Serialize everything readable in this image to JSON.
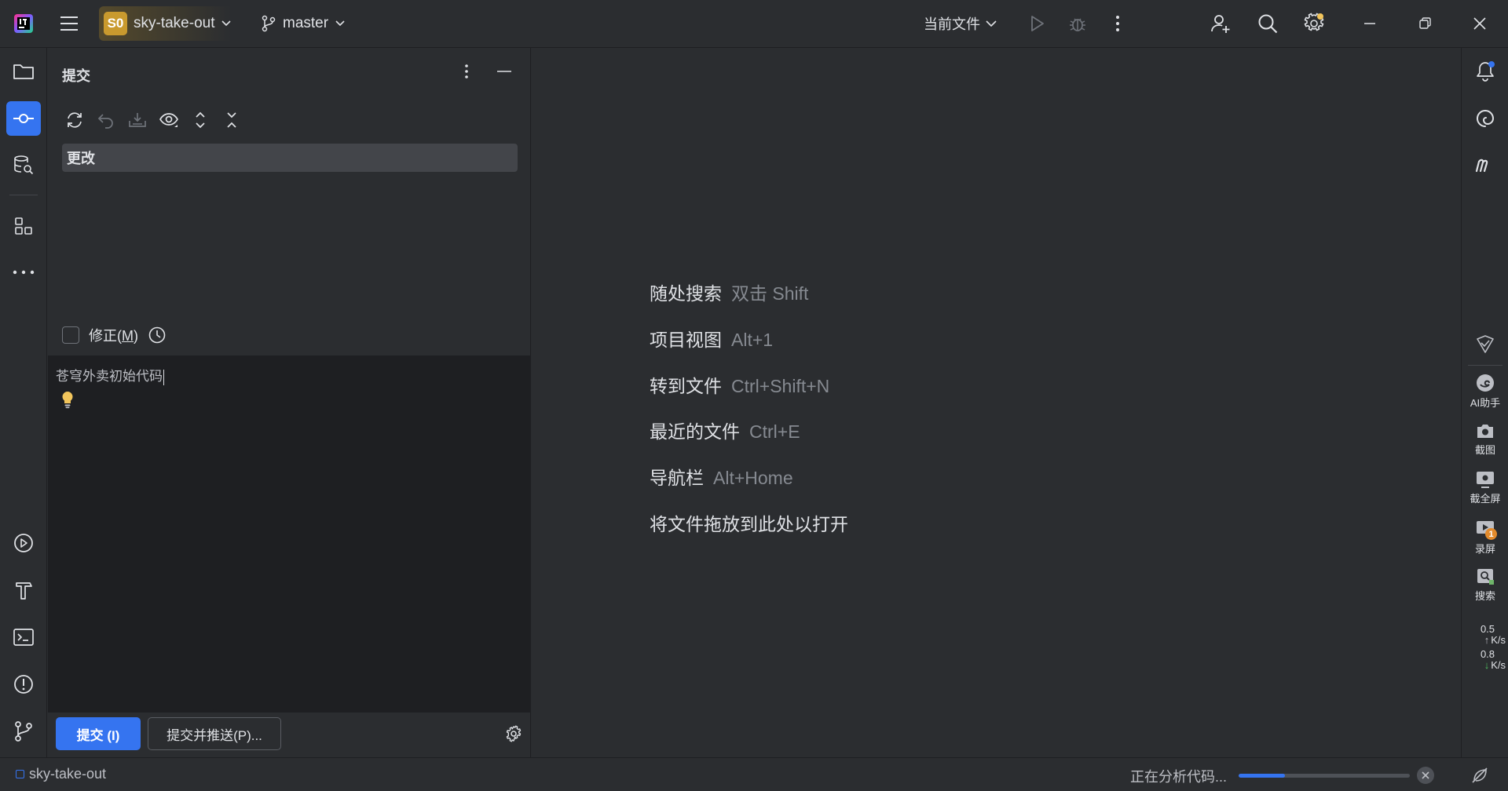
{
  "titlebar": {
    "project_badge": "S0",
    "project_name": "sky-take-out",
    "branch": "master",
    "run_config": "当前文件"
  },
  "commit_panel": {
    "title": "提交",
    "changes_node": "更改",
    "amend_label_prefix": "修正(",
    "amend_mnemonic": "M",
    "amend_label_suffix": ")",
    "commit_message": "苍穹外卖初始代码",
    "commit_button": "提交 (I)",
    "commit_push_button": "提交并推送(P)..."
  },
  "editor_hints": [
    {
      "action": "随处搜索",
      "key": "双击 Shift"
    },
    {
      "action": "项目视图",
      "key": "Alt+1"
    },
    {
      "action": "转到文件",
      "key": "Ctrl+Shift+N"
    },
    {
      "action": "最近的文件",
      "key": "Ctrl+E"
    },
    {
      "action": "导航栏",
      "key": "Alt+Home"
    },
    {
      "action": "将文件拖放到此处以打开",
      "key": ""
    }
  ],
  "float_tools": {
    "ai": "AI助手",
    "screenshot": "截图",
    "fullscreen": "截全屏",
    "record": "录屏",
    "record_badge": "1",
    "search": "搜索",
    "upload_speed": "0.5",
    "upload_unit": "K/s",
    "download_speed": "0.8",
    "download_unit": "K/s"
  },
  "statusbar": {
    "project": "sky-take-out",
    "progress_text": "正在分析代码...",
    "progress_fraction": 0.27
  },
  "colors": {
    "accent": "#3574f0",
    "background": "#2b2d30",
    "editor_dark": "#1e1f22",
    "project_badge": "#c99a2e",
    "notification_dot": "#3574f0",
    "settings_dot": "#f2c55c"
  }
}
